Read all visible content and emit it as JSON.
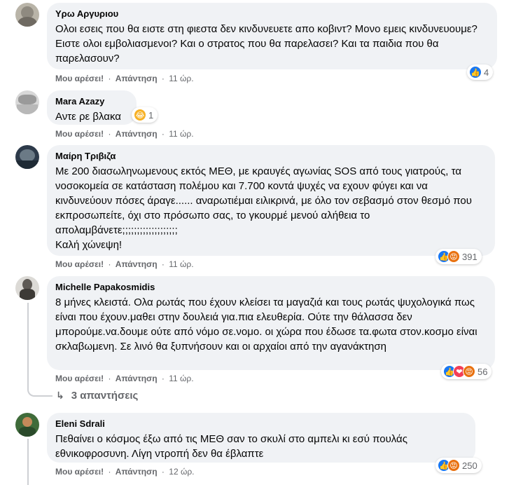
{
  "labels": {
    "like": "Μου αρέσει!",
    "reply": "Απάντηση",
    "separator": "·"
  },
  "comments": [
    {
      "author": "Υρω Αργυριου",
      "text": "Ολοι εσεις που θα ειστε στη φιεστα δεν κινδυνευετε απο κοβιντ? Μονο εμεις κινδυνευουμε? Ειστε ολοι εμβολιασμενοι? Και ο στρατος που θα παρελασει? Και τα παιδια που θα παρελασουν?",
      "time": "11 ώρ.",
      "reactions": {
        "icons": [
          "like-icon"
        ],
        "count": "4"
      }
    },
    {
      "author": "Mara Azazy",
      "text": "Αντε ρε βλακα",
      "time": "11 ώρ.",
      "reactions": {
        "icons": [
          "haha-icon"
        ],
        "count": "1"
      }
    },
    {
      "author": "Μαίρη Τριβιζα",
      "text": "Με 200 διασωληνωμενους εκτός ΜΕΘ, με κραυγές αγωνίας SOS από τους γιατρούς, τα νοσοκομεία σε κατάσταση πολέμου και 7.700 κοντά ψυχές να εχουν φύγει και να κινδυνεύουν πόσες άραγε...... αναρωτιέμαι ειλικρινά, με όλο τον σεβασμό στον θεσμό που εκπροσωπείτε, όχι στο πρόσωπο σας, το γκουρμέ μενού αλήθεια το απολαμβάνετε;;;;;;;;;;;;;;;;;;;",
      "text2": "Καλή χώνεψη!",
      "time": "11 ώρ.",
      "reactions": {
        "icons": [
          "like-icon",
          "angry-icon"
        ],
        "count": "391"
      }
    },
    {
      "author": "Michelle Papakosmidis",
      "text": "8 μήνες κλειστά. Ολα ρωτάς που έχουν κλείσει τα μαγαζιά και τους ρωτάς ψυχολογικά πως είναι που έχουν.μαθει στην δουλειά για.πια ελευθερία. Ούτε την θάλασσα δεν μπορούμε.να.δουμε ούτε από νόμο σε.νομο. οι χώρα που έδωσε τα.φωτα στον.κοσμο είναι σκλαβωμενη. Σε λινό θα ξυπνήσουν και οι αρχαίοι από την αγανάκτηση",
      "time": "11 ώρ.",
      "reactions": {
        "icons": [
          "like-icon",
          "love-icon",
          "angry-icon"
        ],
        "count": "56"
      },
      "replies_label": "3 απαντήσεις"
    },
    {
      "author": "Eleni Sdrali",
      "text": "Πεθαίνει ο κόσμος έξω από τις ΜΕΘ σαν το σκυλί στο αμπελι κι εσύ πουλάς εθνικοφροσυνη. Λίγη ντροπή δεν θα έβλαπτε",
      "time": "12 ώρ.",
      "reactions": {
        "icons": [
          "like-icon",
          "angry-icon"
        ],
        "count": "250"
      }
    }
  ],
  "colors": {
    "bubble": "#f0f2f5",
    "secondary_text": "#65676b",
    "like": "#1877f2",
    "angry": "#e9710f",
    "haha": "#f7b125",
    "love": "#f33e58"
  }
}
